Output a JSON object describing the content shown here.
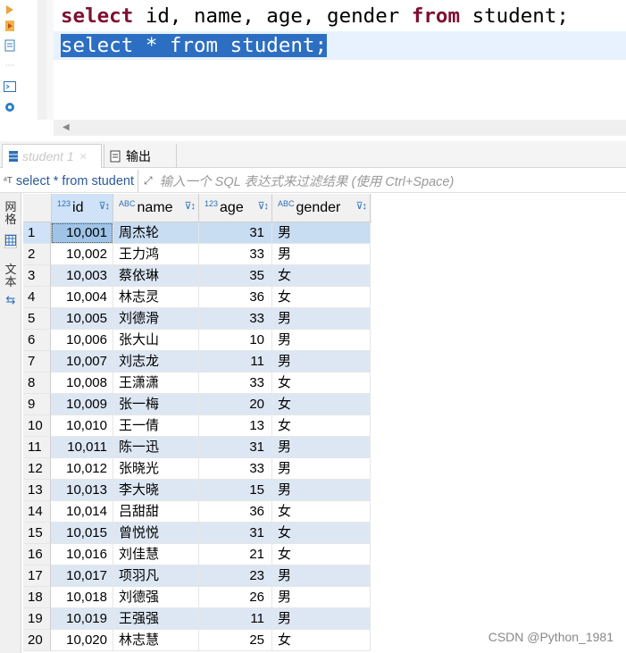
{
  "editor": {
    "line1": {
      "kw1": "select",
      "mid": " id, name, age, gender ",
      "kw2": "from",
      "rest": " student;"
    },
    "line2": {
      "kw1": "select",
      "mid": " * ",
      "kw2": "from",
      "rest": " student;"
    },
    "gutter_icons": [
      "run-icon",
      "execute-script-icon",
      "explain-icon",
      "terminal-icon",
      "gear-icon"
    ]
  },
  "tabs": [
    {
      "label": "student 1",
      "close": "✕"
    },
    {
      "label": "输出"
    }
  ],
  "filter": {
    "query": "select * from student",
    "placeholder": "输入一个 SQL 表达式来过滤结果 (使用 Ctrl+Space)"
  },
  "side_strip": {
    "grid_label": "网格",
    "text_label": "文本"
  },
  "grid": {
    "columns": [
      {
        "type_tag": "123",
        "label": "id"
      },
      {
        "type_tag": "ABC",
        "label": "name"
      },
      {
        "type_tag": "123",
        "label": "age"
      },
      {
        "type_tag": "ABC",
        "label": "gender"
      }
    ],
    "rows": [
      {
        "n": "1",
        "id": "10,001",
        "name": "周杰轮",
        "age": "31",
        "gender": "男"
      },
      {
        "n": "2",
        "id": "10,002",
        "name": "王力鸿",
        "age": "33",
        "gender": "男"
      },
      {
        "n": "3",
        "id": "10,003",
        "name": "蔡依琳",
        "age": "35",
        "gender": "女"
      },
      {
        "n": "4",
        "id": "10,004",
        "name": "林志灵",
        "age": "36",
        "gender": "女"
      },
      {
        "n": "5",
        "id": "10,005",
        "name": "刘德滑",
        "age": "33",
        "gender": "男"
      },
      {
        "n": "6",
        "id": "10,006",
        "name": "张大山",
        "age": "10",
        "gender": "男"
      },
      {
        "n": "7",
        "id": "10,007",
        "name": "刘志龙",
        "age": "11",
        "gender": "男"
      },
      {
        "n": "8",
        "id": "10,008",
        "name": "王潇潇",
        "age": "33",
        "gender": "女"
      },
      {
        "n": "9",
        "id": "10,009",
        "name": "张一梅",
        "age": "20",
        "gender": "女"
      },
      {
        "n": "10",
        "id": "10,010",
        "name": "王一倩",
        "age": "13",
        "gender": "女"
      },
      {
        "n": "11",
        "id": "10,011",
        "name": "陈一迅",
        "age": "31",
        "gender": "男"
      },
      {
        "n": "12",
        "id": "10,012",
        "name": "张晓光",
        "age": "33",
        "gender": "男"
      },
      {
        "n": "13",
        "id": "10,013",
        "name": "李大晓",
        "age": "15",
        "gender": "男"
      },
      {
        "n": "14",
        "id": "10,014",
        "name": "吕甜甜",
        "age": "36",
        "gender": "女"
      },
      {
        "n": "15",
        "id": "10,015",
        "name": "曾悦悦",
        "age": "31",
        "gender": "女"
      },
      {
        "n": "16",
        "id": "10,016",
        "name": "刘佳慧",
        "age": "21",
        "gender": "女"
      },
      {
        "n": "17",
        "id": "10,017",
        "name": "项羽凡",
        "age": "23",
        "gender": "男"
      },
      {
        "n": "18",
        "id": "10,018",
        "name": "刘德强",
        "age": "26",
        "gender": "男"
      },
      {
        "n": "19",
        "id": "10,019",
        "name": "王强强",
        "age": "11",
        "gender": "男"
      },
      {
        "n": "20",
        "id": "10,020",
        "name": "林志慧",
        "age": "25",
        "gender": "女"
      }
    ]
  },
  "watermark": "CSDN @Python_1981",
  "colors": {
    "keyword": "#7f0f30",
    "selection": "#2c6fc2",
    "row_alt": "#dde7f4",
    "header_selected": "#cfe2f7"
  }
}
